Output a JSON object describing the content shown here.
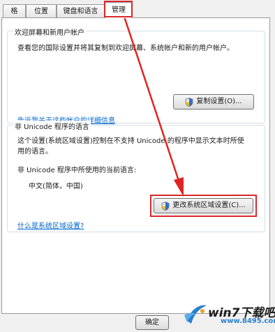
{
  "tabs": [
    {
      "label": "格式"
    },
    {
      "label": "位置"
    },
    {
      "label": "键盘和语言"
    },
    {
      "label": "管理"
    }
  ],
  "welcome_group": {
    "title": "欢迎屏幕和新用户帐户",
    "description": "查看您的国际设置并将其复制到欢迎屏幕、系统帐户和新的用户帐户。",
    "copy_button": "复制设置(O)...",
    "details_link": "告诉我关于这些帐户的详细信息"
  },
  "unicode_group": {
    "title": "非 Unicode 程序的语言",
    "description_line1": "这个设置(系统区域设置)控制在不支持 Unicode 的程序中显示文本时所使",
    "description_line2": "用的语言。",
    "current_label": "非 Unicode 程序中所使用的当前语言:",
    "current_value": "中文(简体，中国)",
    "change_button": "更改系统区域设置(C)...",
    "help_link": "什么是系统区域设置?"
  },
  "footer": {
    "ok_button": "确定"
  },
  "watermark": {
    "brand": "win7下载吧",
    "url": "www.8495.com"
  },
  "colors": {
    "highlight": "#d9292b",
    "link": "#0066cc"
  }
}
